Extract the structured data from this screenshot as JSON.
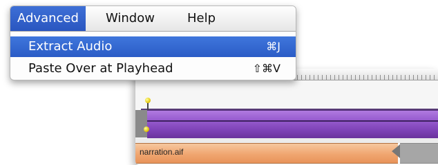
{
  "menubar": {
    "items": [
      {
        "label": "Advanced",
        "active": true
      },
      {
        "label": "Window",
        "active": false
      },
      {
        "label": "Help",
        "active": false
      }
    ]
  },
  "menu": {
    "items": [
      {
        "label": "Extract Audio",
        "shortcut": "⌘J",
        "selected": true
      },
      {
        "label": "Paste Over at Playhead",
        "shortcut": "⇧⌘V",
        "selected": false
      }
    ]
  },
  "timeline": {
    "audio_clip": {
      "label": "narration.aif"
    },
    "colors": {
      "video_track": "#9a5fd1",
      "audio_track": "#f0a670",
      "playhead": "#e0c000"
    }
  }
}
